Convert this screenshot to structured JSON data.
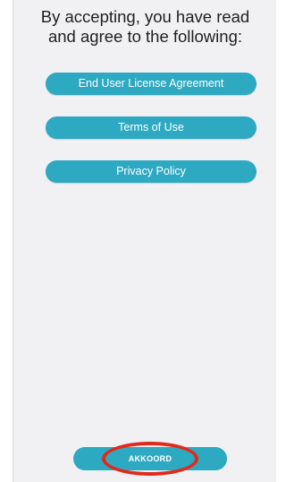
{
  "header": {
    "line1": "By accepting, you have read",
    "line2": "and agree to the following:"
  },
  "documents": [
    {
      "label": "End User License Agreement"
    },
    {
      "label": "Terms of Use"
    },
    {
      "label": "Privacy Policy"
    }
  ],
  "accept": {
    "label": "AKKOORD"
  },
  "colors": {
    "accent": "#2ea9c2",
    "background": "#f1f1f4",
    "highlight": "#e02a1c"
  }
}
